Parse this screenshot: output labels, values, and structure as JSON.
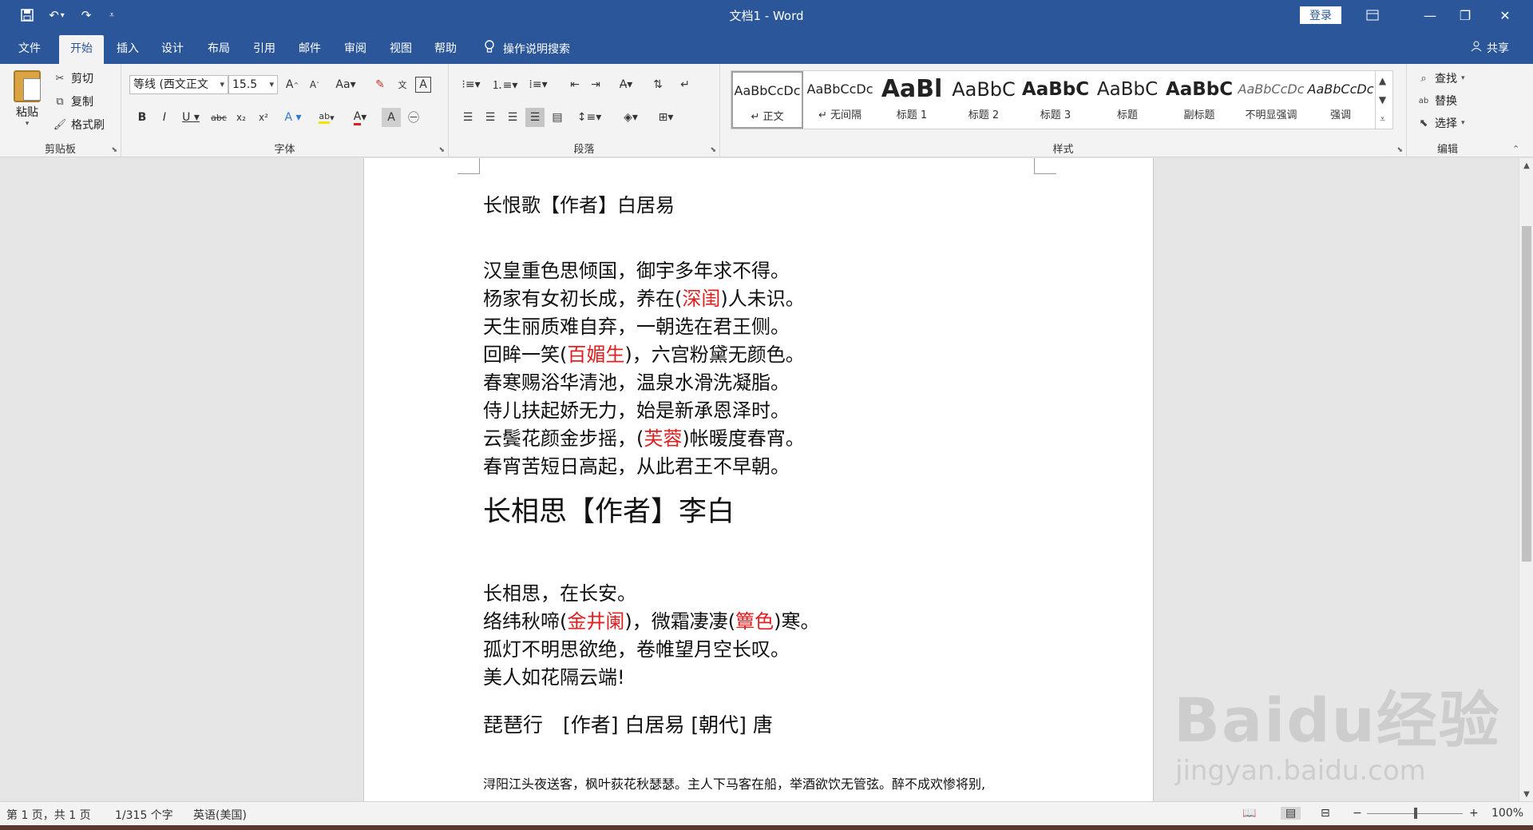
{
  "window": {
    "title": "文档1 - Word",
    "login_label": "登录"
  },
  "qat": {
    "save_icon": "save-icon",
    "undo_icon": "undo-icon",
    "redo_icon": "redo-icon"
  },
  "tabs": [
    "文件",
    "开始",
    "插入",
    "设计",
    "布局",
    "引用",
    "邮件",
    "审阅",
    "视图",
    "帮助"
  ],
  "tell_me": "操作说明搜索",
  "share": "共享",
  "clipboard": {
    "paste": "粘贴",
    "cut": "剪切",
    "copy": "复制",
    "format_painter": "格式刷",
    "label": "剪贴板"
  },
  "font": {
    "name": "等线 (西文正文",
    "size": "15.5",
    "label": "字体"
  },
  "paragraph": {
    "label": "段落"
  },
  "styles": {
    "label": "样式",
    "items": [
      {
        "preview": "AaBbCcDc",
        "name": "↵ 正文"
      },
      {
        "preview": "AaBbCcDc",
        "name": "↵ 无间隔"
      },
      {
        "preview": "AaBl",
        "name": "标题 1"
      },
      {
        "preview": "AaBbC",
        "name": "标题 2"
      },
      {
        "preview": "AaBbC",
        "name": "标题 3"
      },
      {
        "preview": "AaBbC",
        "name": "标题"
      },
      {
        "preview": "AaBbC",
        "name": "副标题"
      },
      {
        "preview": "AaBbCcDc",
        "name": "不明显强调"
      },
      {
        "preview": "AaBbCcDc",
        "name": "强调"
      }
    ]
  },
  "editing": {
    "find": "查找",
    "replace": "替换",
    "select": "选择",
    "label": "编辑"
  },
  "document": {
    "title1": "长恨歌【作者】白居易",
    "poem1": [
      {
        "a": "汉皇重色思倾国，御宇多年求不得。",
        "r": "",
        "b": ""
      },
      {
        "a": "杨家有女初长成，养在(",
        "r": "深闺",
        "b": ")人未识。"
      },
      {
        "a": "天生丽质难自弃，一朝选在君王侧。",
        "r": "",
        "b": ""
      },
      {
        "a": "回眸一笑(",
        "r": "百媚生",
        "b": ")，六宫粉黛无颜色。"
      },
      {
        "a": "春寒赐浴华清池，温泉水滑洗凝脂。",
        "r": "",
        "b": ""
      },
      {
        "a": "侍儿扶起娇无力，始是新承恩泽时。",
        "r": "",
        "b": ""
      },
      {
        "a": "云鬓花颜金步摇，(",
        "r": "芙蓉",
        "b": ")帐暖度春宵。"
      },
      {
        "a": "春宵苦短日高起，从此君王不早朝。",
        "r": "",
        "b": ""
      }
    ],
    "title2": "长相思【作者】李白",
    "poem2_l1": "长相思，在长安。",
    "poem2_l2a": "络纬秋啼(",
    "poem2_l2r1": "金井阑",
    "poem2_l2b": ")，微霜凄凄(",
    "poem2_l2r2": "簟色",
    "poem2_l2c": ")寒。",
    "poem2_l3": "孤灯不明思欲绝，卷帷望月空长叹。",
    "poem2_l4": "美人如花隔云端!",
    "title3": "琵琶行　[作者] 白居易 [朝代] 唐",
    "poem3_l1": "浔阳江头夜送客，枫叶荻花秋瑟瑟。主人下马客在船，举酒欲饮无管弦。醉不成欢惨将别,"
  },
  "status": {
    "page": "第 1 页，共 1 页",
    "words": "1/315 个字",
    "language": "英语(美国)",
    "zoom": "100%",
    "zoom_minus": "−",
    "zoom_plus": "+"
  },
  "watermark": {
    "main": "Baidu经验",
    "sub": "jingyan.baidu.com"
  },
  "colors": {
    "accent": "#2b579a",
    "red_text": "#e02020"
  }
}
